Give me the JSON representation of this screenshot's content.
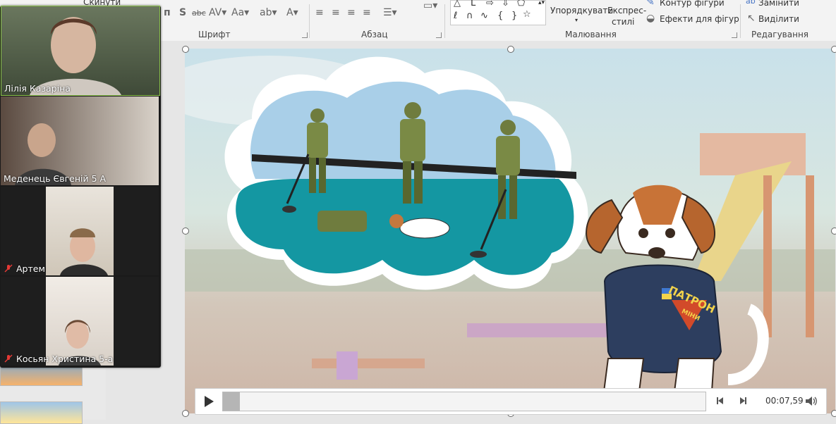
{
  "ribbon": {
    "top_cut_label": "Скинути",
    "groups": {
      "font": "Шрифт",
      "paragraph": "Абзац",
      "drawing": "Малювання",
      "editing": "Редагування"
    },
    "buttons": {
      "arrange": "Упорядкувати",
      "quick_styles_line1": "Експрес-",
      "quick_styles_line2": "стилі",
      "shape_outline": "Контур фігури",
      "shape_effects": "Ефекти для фігур",
      "replace": "Замінити",
      "select": "Виділити"
    }
  },
  "slide": {
    "vest_text_top": "ПАТРОН",
    "vest_text_bottom": "МІНИ"
  },
  "player": {
    "time": "00:07,59",
    "progress": 0.035
  },
  "participants": [
    {
      "name": "Лілія Казаріна",
      "muted": false
    },
    {
      "name": "Меденець Євгеній 5 А",
      "muted": false
    },
    {
      "name": "Артем",
      "muted": true
    },
    {
      "name": "Косьян Христина 5-а",
      "muted": true
    }
  ]
}
